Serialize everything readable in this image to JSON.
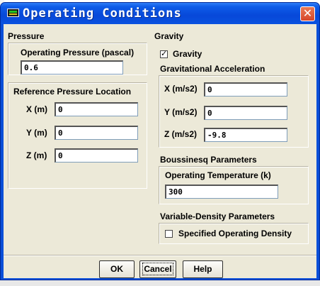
{
  "window": {
    "title": "Operating Conditions"
  },
  "pressure": {
    "group_label": "Pressure",
    "operating_label": "Operating Pressure (pascal)",
    "operating_value": "0.6",
    "reference_label": "Reference Pressure Location",
    "x_label": "X (m)",
    "x_value": "0",
    "y_label": "Y (m)",
    "y_value": "0",
    "z_label": "Z (m)",
    "z_value": "0"
  },
  "gravity": {
    "group_label": "Gravity",
    "checkbox_label": "Gravity",
    "checkbox_checked": true,
    "accel_label": "Gravitational Acceleration",
    "x_label": "X (m/s2)",
    "x_value": "0",
    "y_label": "Y (m/s2)",
    "y_value": "0",
    "z_label": "Z (m/s2)",
    "z_value": "-9.8"
  },
  "boussinesq": {
    "group_label": "Boussinesq Parameters",
    "temp_label": "Operating Temperature (k)",
    "temp_value": "300"
  },
  "variable_density": {
    "group_label": "Variable-Density Parameters",
    "checkbox_label": "Specified Operating Density",
    "checkbox_checked": false
  },
  "buttons": {
    "ok": "OK",
    "cancel": "Cancel",
    "help": "Help"
  }
}
